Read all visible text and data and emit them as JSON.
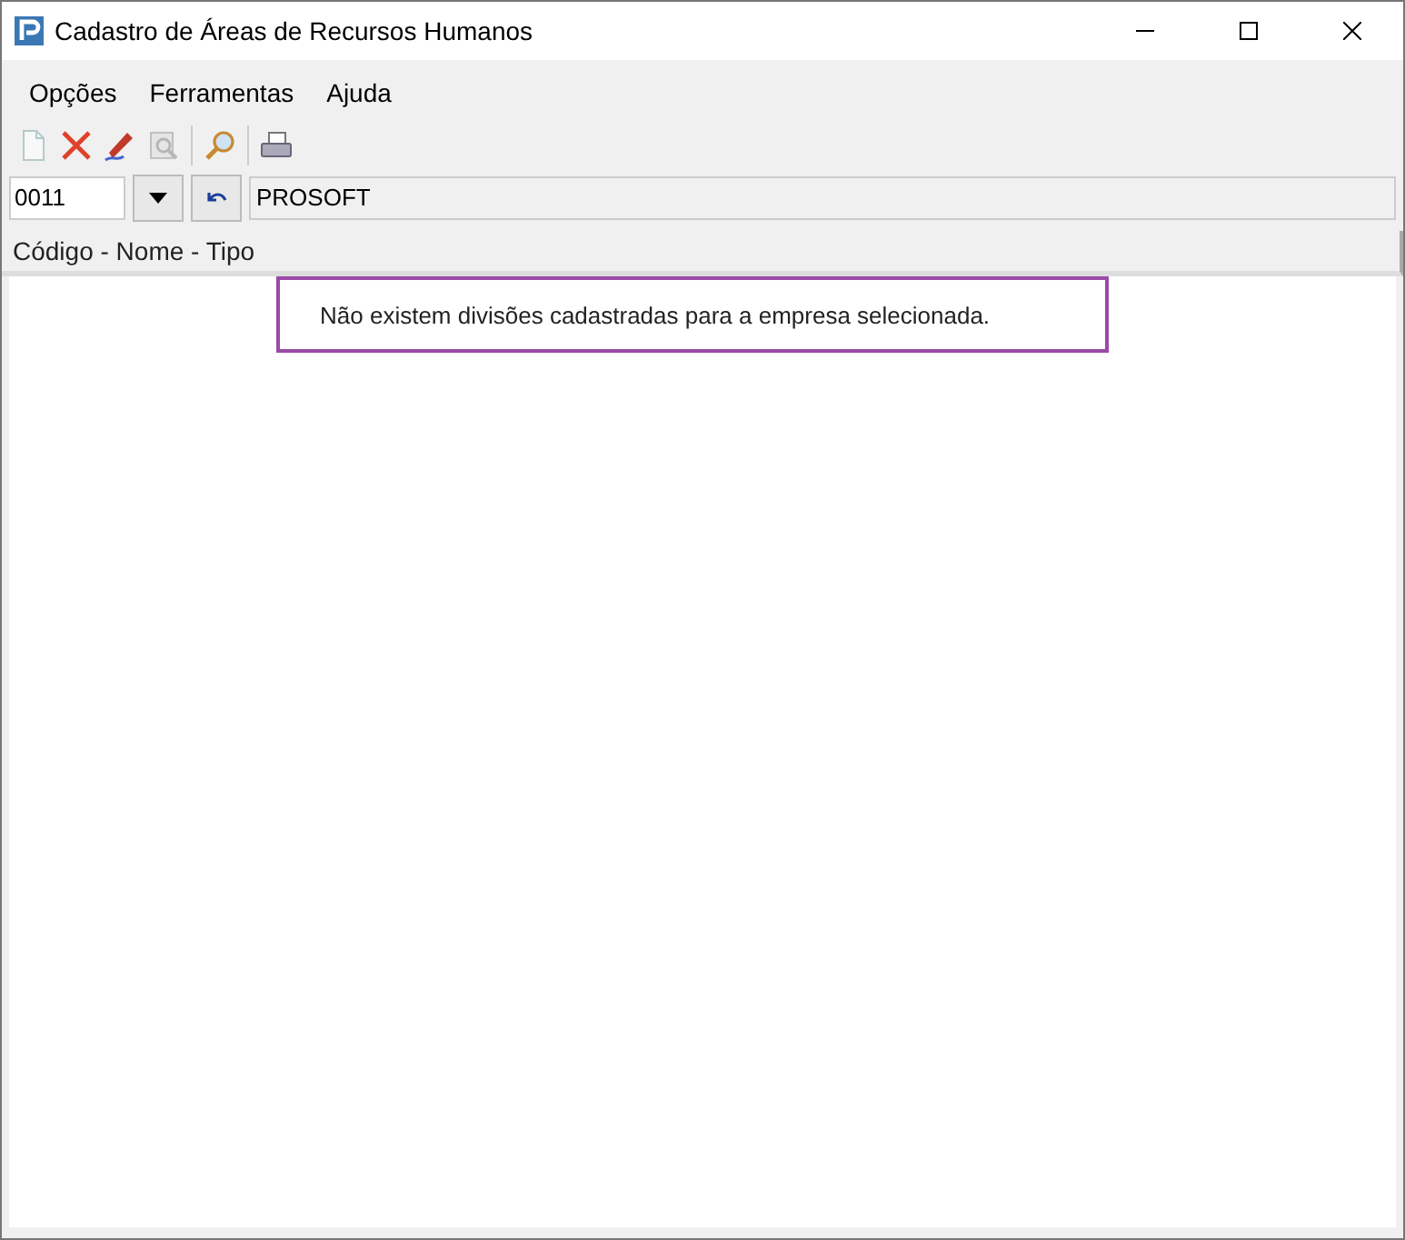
{
  "window": {
    "title": "Cadastro de Áreas de Recursos Humanos"
  },
  "menu": [
    "Opções",
    "Ferramentas",
    "Ajuda"
  ],
  "toolbar": [
    {
      "kind": "new",
      "disabled": true
    },
    {
      "kind": "delete",
      "disabled": false
    },
    {
      "kind": "edit",
      "disabled": false
    },
    {
      "kind": "preview",
      "disabled": true
    },
    {
      "kind": "search",
      "disabled": false
    },
    {
      "kind": "print",
      "disabled": false
    }
  ],
  "company": {
    "code": "0011",
    "name": "PROSOFT"
  },
  "list": {
    "header": "Código - Nome - Tipo",
    "message": "Não existem divisões cadastradas para a empresa selecionada."
  }
}
